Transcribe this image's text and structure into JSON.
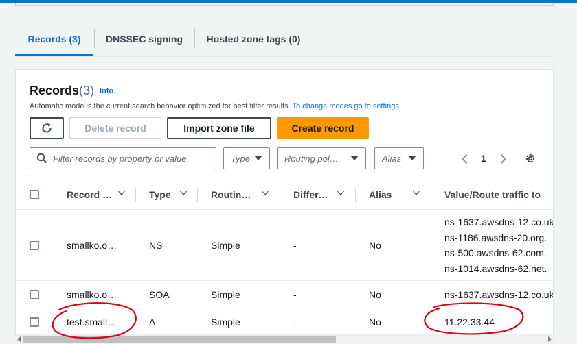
{
  "tabs": [
    {
      "label": "Records (3)",
      "active": true
    },
    {
      "label": "DNSSEC signing",
      "active": false
    },
    {
      "label": "Hosted zone tags (0)",
      "active": false
    }
  ],
  "header": {
    "title": "Records",
    "count": "(3)",
    "info": "Info",
    "description": "Automatic mode is the current search behavior optimized for best filter results.",
    "description_link": "To change modes go to settings."
  },
  "toolbar": {
    "refresh_icon": "refresh-icon",
    "delete_label": "Delete record",
    "import_label": "Import zone file",
    "create_label": "Create record"
  },
  "filters": {
    "search_placeholder": "Filter records by property or value",
    "type": "Type",
    "routing": "Routing pol…",
    "alias": "Alias"
  },
  "pagination": {
    "page": "1"
  },
  "columns": [
    "Record …",
    "Type",
    "Routin…",
    "Differ…",
    "Alias",
    "Value/Route traffic to"
  ],
  "rows": [
    {
      "name": "smallko.o…",
      "type": "NS",
      "routing": "Simple",
      "differ": "-",
      "alias": "No",
      "values": [
        "ns-1637.awsdns-12.co.uk",
        "ns-1186.awsdns-20.org.",
        "ns-500.awsdns-62.com.",
        "ns-1014.awsdns-62.net."
      ]
    },
    {
      "name": "smallko.o…",
      "type": "SOA",
      "routing": "Simple",
      "differ": "-",
      "alias": "No",
      "values": [
        "ns-1637.awsdns-12.co.uk"
      ]
    },
    {
      "name": "test.small…",
      "type": "A",
      "routing": "Simple",
      "differ": "-",
      "alias": "No",
      "values": [
        "11.22.33.44"
      ]
    }
  ],
  "colors": {
    "accent": "#0972d3",
    "primary_button": "#ff9900",
    "annotation": "#e0000f"
  }
}
